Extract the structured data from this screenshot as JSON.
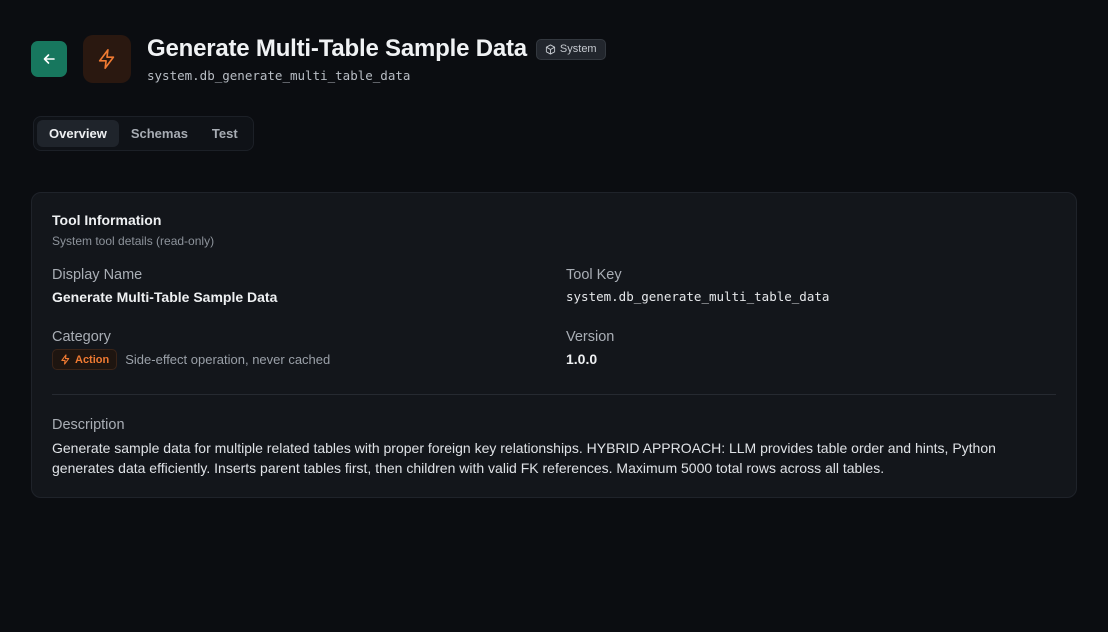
{
  "header": {
    "title": "Generate Multi-Table Sample Data",
    "badge": "System",
    "tool_key": "system.db_generate_multi_table_data",
    "back_icon": "arrow-left-icon",
    "tool_icon": "lightning-bolt-icon"
  },
  "tabs": [
    {
      "label": "Overview",
      "active": true
    },
    {
      "label": "Schemas",
      "active": false
    },
    {
      "label": "Test",
      "active": false
    }
  ],
  "card": {
    "title": "Tool Information",
    "subtitle": "System tool details (read-only)",
    "display_name": {
      "label": "Display Name",
      "value": "Generate Multi-Table Sample Data"
    },
    "tool_key": {
      "label": "Tool Key",
      "value": "system.db_generate_multi_table_data"
    },
    "category": {
      "label": "Category",
      "badge": "Action",
      "note": "Side-effect operation, never cached"
    },
    "version": {
      "label": "Version",
      "value": "1.0.0"
    },
    "description": {
      "label": "Description",
      "value": "Generate sample data for multiple related tables with proper foreign key relationships. HYBRID APPROACH: LLM provides table order and hints, Python generates data efficiently. Inserts parent tables first, then children with valid FK references. Maximum 5000 total rows across all tables."
    }
  },
  "colors": {
    "accent_green": "#17775e",
    "action_orange": "#f07a32",
    "background": "#0b0d11",
    "card": "#13161b"
  }
}
